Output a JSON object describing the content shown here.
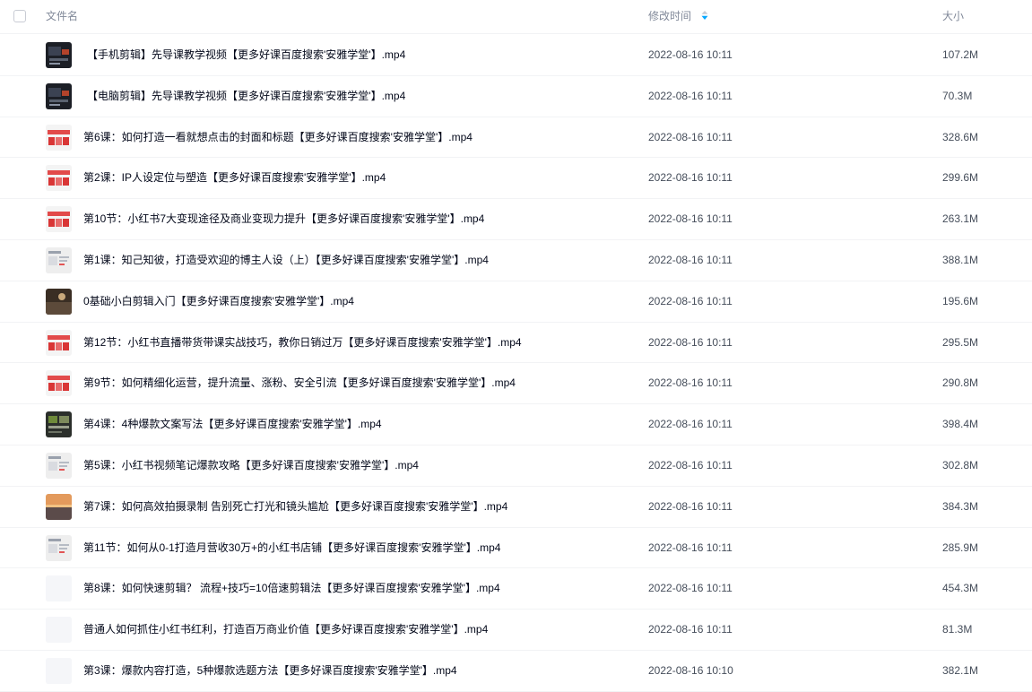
{
  "header": {
    "name_label": "文件名",
    "time_label": "修改时间",
    "size_label": "大小"
  },
  "colors": {
    "accent": "#06a7ff",
    "text": "#03081a",
    "muted": "#818999",
    "divider": "#f2f3f5"
  },
  "files": [
    {
      "name": "【手机剪辑】先导课教学视频【更多好课百度搜索'安雅学堂'】.mp4",
      "time": "2022-08-16 10:11",
      "size": "107.2M",
      "thumb": "dark"
    },
    {
      "name": "【电脑剪辑】先导课教学视频【更多好课百度搜索'安雅学堂'】.mp4",
      "time": "2022-08-16 10:11",
      "size": "70.3M",
      "thumb": "dark"
    },
    {
      "name": "第6课：如何打造一看就想点击的封面和标题【更多好课百度搜索'安雅学堂'】.mp4",
      "time": "2022-08-16 10:11",
      "size": "328.6M",
      "thumb": "red"
    },
    {
      "name": "第2课：IP人设定位与塑造【更多好课百度搜索'安雅学堂'】.mp4",
      "time": "2022-08-16 10:11",
      "size": "299.6M",
      "thumb": "red"
    },
    {
      "name": "第10节：小红书7大变现途径及商业变现力提升【更多好课百度搜索'安雅学堂'】.mp4",
      "time": "2022-08-16 10:11",
      "size": "263.1M",
      "thumb": "red"
    },
    {
      "name": "第1课：知己知彼，打造受欢迎的博主人设（上）【更多好课百度搜索'安雅学堂'】.mp4",
      "time": "2022-08-16 10:11",
      "size": "388.1M",
      "thumb": "light"
    },
    {
      "name": "0基础小白剪辑入门【更多好课百度搜索'安雅学堂'】.mp4",
      "time": "2022-08-16 10:11",
      "size": "195.6M",
      "thumb": "photo"
    },
    {
      "name": "第12节：小红书直播带货带课实战技巧，教你日销过万【更多好课百度搜索'安雅学堂'】.mp4",
      "time": "2022-08-16 10:11",
      "size": "295.5M",
      "thumb": "red"
    },
    {
      "name": "第9节：如何精细化运营，提升流量、涨粉、安全引流【更多好课百度搜索'安雅学堂'】.mp4",
      "time": "2022-08-16 10:11",
      "size": "290.8M",
      "thumb": "red"
    },
    {
      "name": "第4课：4种爆款文案写法【更多好课百度搜索'安雅学堂'】.mp4",
      "time": "2022-08-16 10:11",
      "size": "398.4M",
      "thumb": "green"
    },
    {
      "name": "第5课：小红书视频笔记爆款攻略【更多好课百度搜索'安雅学堂'】.mp4",
      "time": "2022-08-16 10:11",
      "size": "302.8M",
      "thumb": "light"
    },
    {
      "name": "第7课：如何高效拍摄录制 告别死亡打光和镜头尴尬【更多好课百度搜索'安雅学堂'】.mp4",
      "time": "2022-08-16 10:11",
      "size": "384.3M",
      "thumb": "sunset"
    },
    {
      "name": "第11节：如何从0-1打造月营收30万+的小红书店铺【更多好课百度搜索'安雅学堂'】.mp4",
      "time": "2022-08-16 10:11",
      "size": "285.9M",
      "thumb": "light"
    },
    {
      "name": "第8课：如何快速剪辑？ 流程+技巧=10倍速剪辑法【更多好课百度搜索'安雅学堂'】.mp4",
      "time": "2022-08-16 10:11",
      "size": "454.3M",
      "thumb": "blank"
    },
    {
      "name": "普通人如何抓住小红书红利，打造百万商业价值【更多好课百度搜索'安雅学堂'】.mp4",
      "time": "2022-08-16 10:11",
      "size": "81.3M",
      "thumb": "blank"
    },
    {
      "name": "第3课：爆款内容打造，5种爆款选题方法【更多好课百度搜索'安雅学堂'】.mp4",
      "time": "2022-08-16 10:10",
      "size": "382.1M",
      "thumb": "blank"
    }
  ]
}
